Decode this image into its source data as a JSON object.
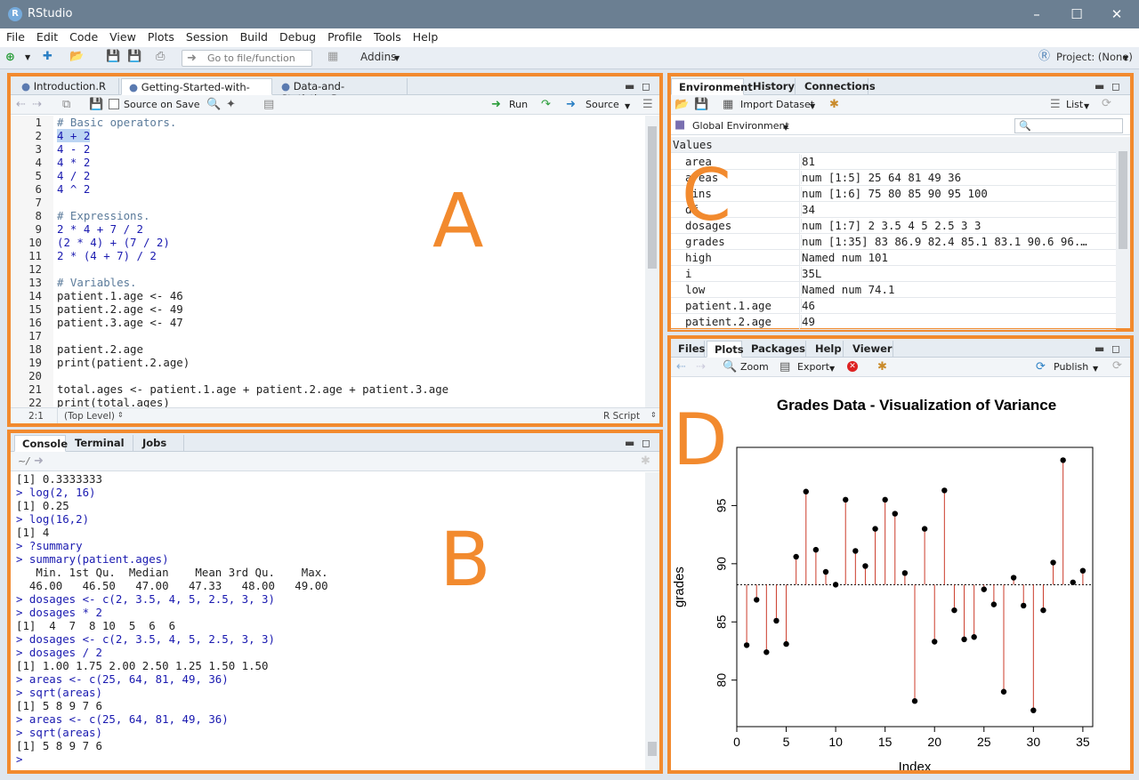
{
  "app": {
    "title": "RStudio",
    "logo": "R"
  },
  "menu": [
    "File",
    "Edit",
    "Code",
    "View",
    "Plots",
    "Session",
    "Build",
    "Debug",
    "Profile",
    "Tools",
    "Help"
  ],
  "toolbar": {
    "goto_placeholder": "Go to file/function",
    "addins": "Addins",
    "project": "Project: (None)"
  },
  "source": {
    "tabs": [
      "Introduction.R",
      "Getting-Started-with-R.R",
      "Data-and-Statistics.R"
    ],
    "source_on_save": "Source on Save",
    "run": "Run",
    "source_btn": "Source",
    "lines": [
      "# Basic operators.",
      "4 + 2",
      "4 - 2",
      "4 * 2",
      "4 / 2",
      "4 ^ 2",
      "",
      "# Expressions.",
      "2 * 4 + 7 / 2",
      "(2 * 4) + (7 / 2)",
      "2 * (4 + 7) / 2",
      "",
      "# Variables.",
      "patient.1.age <- 46",
      "patient.2.age <- 49",
      "patient.3.age <- 47",
      "",
      "patient.2.age",
      "print(patient.2.age)",
      "",
      "total.ages <- patient.1.age + patient.2.age + patient.3.age",
      "print(total.ages)"
    ],
    "status_pos": "2:1",
    "status_level": "(Top Level)",
    "status_type": "R Script"
  },
  "console": {
    "tabs": [
      "Console",
      "Terminal",
      "Jobs"
    ],
    "path": "~/",
    "lines": [
      {
        "t": "[1] 0.3333333",
        "c": false
      },
      {
        "t": "> log(2, 16)",
        "c": true
      },
      {
        "t": "[1] 0.25",
        "c": false
      },
      {
        "t": "> log(16,2)",
        "c": true
      },
      {
        "t": "[1] 4",
        "c": false
      },
      {
        "t": "> ?summary",
        "c": true
      },
      {
        "t": "> summary(patient.ages)",
        "c": true
      },
      {
        "t": "   Min. 1st Qu.  Median    Mean 3rd Qu.    Max. ",
        "c": false
      },
      {
        "t": "  46.00   46.50   47.00   47.33   48.00   49.00 ",
        "c": false
      },
      {
        "t": "> dosages <- c(2, 3.5, 4, 5, 2.5, 3, 3)",
        "c": true
      },
      {
        "t": "> dosages * 2",
        "c": true
      },
      {
        "t": "[1]  4  7  8 10  5  6  6",
        "c": false
      },
      {
        "t": "> dosages <- c(2, 3.5, 4, 5, 2.5, 3, 3)",
        "c": true
      },
      {
        "t": "> dosages / 2",
        "c": true
      },
      {
        "t": "[1] 1.00 1.75 2.00 2.50 1.25 1.50 1.50",
        "c": false
      },
      {
        "t": "> areas <- c(25, 64, 81, 49, 36)",
        "c": true
      },
      {
        "t": "> sqrt(areas)",
        "c": true
      },
      {
        "t": "[1] 5 8 9 7 6",
        "c": false
      },
      {
        "t": "> areas <- c(25, 64, 81, 49, 36)",
        "c": true
      },
      {
        "t": "> sqrt(areas)",
        "c": true
      },
      {
        "t": "[1] 5 8 9 7 6",
        "c": false
      },
      {
        "t": "> ",
        "c": true
      }
    ]
  },
  "environment": {
    "tabs": [
      "Environment",
      "History",
      "Connections"
    ],
    "import": "Import Dataset",
    "list": "List",
    "scope": "Global Environment",
    "section": "Values",
    "rows": [
      {
        "k": "area",
        "v": "81"
      },
      {
        "k": "areas",
        "v": "num [1:5] 25 64 81 49 36"
      },
      {
        "k": "bins",
        "v": "num [1:6] 75 80 85 90 95 100"
      },
      {
        "k": "df",
        "v": "34"
      },
      {
        "k": "dosages",
        "v": "num [1:7] 2 3.5 4 5 2.5 3 3"
      },
      {
        "k": "grades",
        "v": "num [1:35] 83 86.9 82.4 85.1 83.1 90.6 96.…"
      },
      {
        "k": "high",
        "v": "Named num 101"
      },
      {
        "k": "i",
        "v": "35L"
      },
      {
        "k": "low",
        "v": "Named num 74.1"
      },
      {
        "k": "patient.1.age",
        "v": "46"
      },
      {
        "k": "patient.2.age",
        "v": "49"
      }
    ]
  },
  "files": {
    "tabs": [
      "Files",
      "Plots",
      "Packages",
      "Help",
      "Viewer"
    ],
    "zoom": "Zoom",
    "export": "Export",
    "publish": "Publish"
  },
  "labels": {
    "a": "A",
    "b": "B",
    "c": "C",
    "d": "D"
  },
  "chart_data": {
    "type": "scatter",
    "title": "Grades Data - Visualization of Variance",
    "xlabel": "Index",
    "ylabel": "grades",
    "xlim": [
      0,
      36
    ],
    "ylim": [
      76,
      100
    ],
    "xticks": [
      0,
      5,
      10,
      15,
      20,
      25,
      30,
      35
    ],
    "yticks": [
      80,
      85,
      90,
      95
    ],
    "mean": 88.2,
    "x": [
      1,
      2,
      3,
      4,
      5,
      6,
      7,
      8,
      9,
      10,
      11,
      12,
      13,
      14,
      15,
      16,
      17,
      18,
      19,
      20,
      21,
      22,
      23,
      24,
      25,
      26,
      27,
      28,
      29,
      30,
      31,
      32,
      33,
      34,
      35
    ],
    "values": [
      83,
      86.9,
      82.4,
      85.1,
      83.1,
      90.6,
      96.2,
      91.2,
      89.3,
      88.2,
      95.5,
      91.1,
      89.8,
      93,
      95.5,
      94.3,
      89.2,
      78.2,
      93,
      83.3,
      96.3,
      86,
      83.5,
      83.7,
      87.8,
      86.5,
      79,
      88.8,
      86.4,
      77.4,
      86,
      90.1,
      98.9,
      88.4,
      89.4
    ],
    "colors": {
      "stem": "#cc3b2a",
      "point": "#000000",
      "meanline": "#000000"
    }
  }
}
